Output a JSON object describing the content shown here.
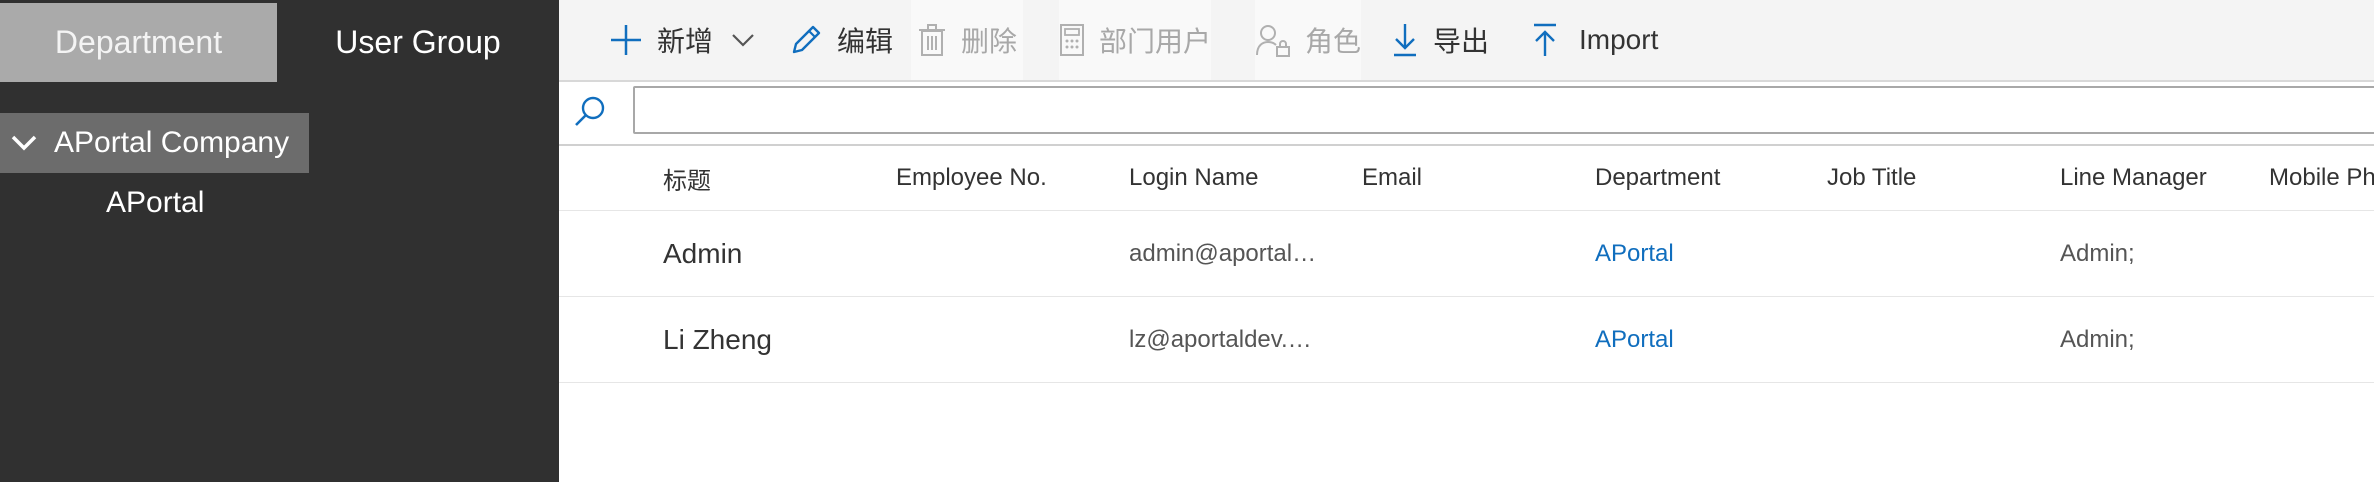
{
  "sidebar": {
    "tabs": [
      {
        "label": "Department"
      },
      {
        "label": "User Group"
      }
    ],
    "tree": {
      "root_label": "APortal Company",
      "children": [
        "APortal"
      ]
    }
  },
  "toolbar": {
    "new_label": "新增",
    "edit_label": "编辑",
    "delete_label": "删除",
    "dept_users_label": "部门用户",
    "role_label": "角色",
    "export_label": "导出",
    "import_label": "Import"
  },
  "search": {
    "value": "",
    "placeholder": ""
  },
  "table": {
    "columns": [
      "标题",
      "Employee No.",
      "Login Name",
      "Email",
      "Department",
      "Job Title",
      "Line Manager",
      "Mobile Ph"
    ],
    "rows": [
      {
        "title": "Admin",
        "employee_no": "",
        "login_name": "admin@aportal…",
        "email": "",
        "department": "APortal",
        "job_title": "",
        "line_manager": "Admin;",
        "mobile": ""
      },
      {
        "title": "Li Zheng",
        "employee_no": "",
        "login_name": "lz@aportaldev.…",
        "email": "",
        "department": "APortal",
        "job_title": "",
        "line_manager": "Admin;",
        "mobile": ""
      }
    ]
  },
  "colors": {
    "sidebar_bg": "#303030",
    "active_tab_bg": "#aaaaaa",
    "selected_node_bg": "#6c6c6c",
    "toolbar_bg": "#f4f4f4",
    "accent": "#106ebe",
    "disabled_text": "#a8a8a8"
  },
  "icons": {
    "new": "plus-icon",
    "new_dropdown": "chevron-down-icon",
    "edit": "pencil-icon",
    "delete": "trash-icon",
    "dept_users": "calculator-icon",
    "role": "user-lock-icon",
    "export": "arrow-down-icon",
    "import": "arrow-up-icon",
    "search": "search-icon",
    "tree_toggle": "chevron-down-icon"
  }
}
